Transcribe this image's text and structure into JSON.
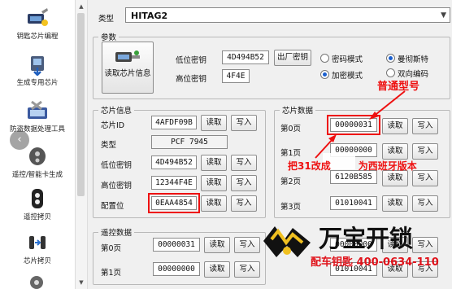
{
  "sidebar": {
    "items": [
      {
        "label": "钥匙芯片编程",
        "icon": "key-chip-programming-icon"
      },
      {
        "label": "生成专用芯片",
        "icon": "generate-chip-icon"
      },
      {
        "label": "防盗数据处理工具",
        "icon": "immobilizer-data-tool-icon"
      },
      {
        "label": "遥控/智能卡生成",
        "icon": "remote-smartcard-icon"
      },
      {
        "label": "遥控拷贝",
        "icon": "remote-copy-icon"
      },
      {
        "label": "芯片拷贝",
        "icon": "chip-copy-icon"
      }
    ]
  },
  "type_row": {
    "label": "类型",
    "value": "HITAG2"
  },
  "params": {
    "legend": "参数",
    "read_chip_info": "读取芯片信息",
    "low_pw_label": "低位密钥",
    "low_pw_value": "4D494B52",
    "factory_pw_button": "出厂密钥",
    "high_pw_label": "高位密钥",
    "high_pw_value": "4F4E",
    "radio_pw_mode": "密码模式",
    "radio_encrypt_mode": "加密模式",
    "radio_manchester": "曼彻斯特",
    "radio_biphase": "双向编码"
  },
  "chip_info": {
    "legend": "芯片信息",
    "rows": [
      {
        "label": "芯片ID",
        "value": "4AFDF09B",
        "read": "读取",
        "write": "写入"
      },
      {
        "label": "类型",
        "value": "PCF 7945"
      },
      {
        "label": "低位密钥",
        "value": "4D494B52",
        "read": "读取",
        "write": "写入"
      },
      {
        "label": "高位密钥",
        "value": "12344F4E",
        "read": "读取",
        "write": "写入"
      },
      {
        "label": "配置位",
        "value": "0EAA4854",
        "read": "读取",
        "write": "写入"
      }
    ]
  },
  "chip_data": {
    "legend": "芯片数据",
    "rows": [
      {
        "label": "第0页",
        "value": "00000031",
        "read": "读取",
        "write": "写入"
      },
      {
        "label": "第1页",
        "value": "00000000",
        "read": "读取",
        "write": "写入"
      },
      {
        "label": "第2页",
        "value": "6120B585",
        "read": "读取",
        "write": "写入"
      },
      {
        "label": "第3页",
        "value": "01010041",
        "read": "读取",
        "write": "写入"
      }
    ]
  },
  "remote_data": {
    "legend": "遥控数据",
    "rows": [
      {
        "label": "第0页",
        "value": "00000031",
        "read": "读取",
        "write": "写入"
      },
      {
        "label": "第1页",
        "value": "00000000",
        "read": "读取",
        "write": "写入"
      }
    ],
    "right_rows": [
      {
        "value": "00000000",
        "read": "读取",
        "write": "写入"
      },
      {
        "value": "01010041",
        "read": "读取",
        "write": "写入"
      }
    ]
  },
  "annotations": {
    "normal_model": "普通型号",
    "change_31": "把31改成",
    "change_31_tail": "为西班牙版本"
  },
  "watermark": {
    "brand": "万宝开锁",
    "sub": "配车钥匙 400-0634-110"
  },
  "colors": {
    "annotation_red": "#e11111",
    "selected_radio": "#1a5fcf",
    "watermark_red": "#e0121a"
  }
}
